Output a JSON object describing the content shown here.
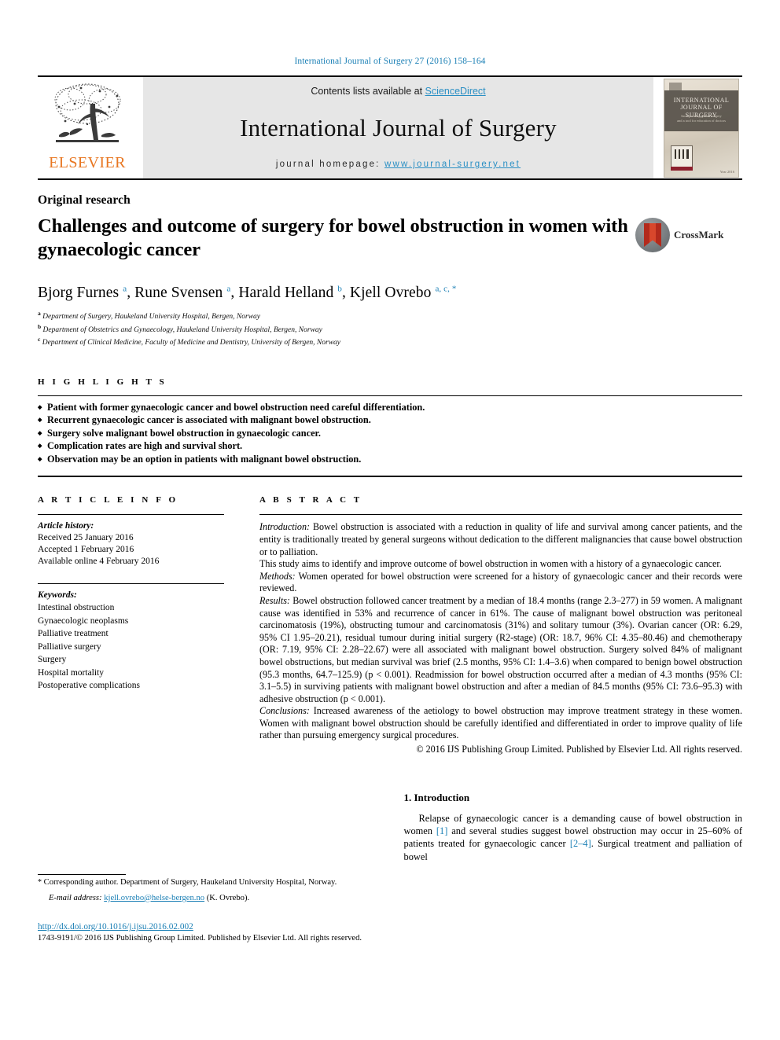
{
  "running_head": "International Journal of Surgery 27 (2016) 158–164",
  "masthead": {
    "publisher_name": "ELSEVIER",
    "contents_prefix": "Contents lists available at ",
    "contents_link": "ScienceDirect",
    "journal_title": "International Journal of Surgery",
    "homepage_prefix": "journal homepage: ",
    "homepage_url": "www.journal-surgery.net",
    "cover": {
      "title_line1": "INTERNATIONAL",
      "title_line2": "JOURNAL OF SURGERY",
      "subtitle_line1": "Incorporating global surgery",
      "subtitle_line2": "and a tool for education of doctors",
      "footer": "Year 2016"
    }
  },
  "article": {
    "type": "Original research",
    "title": "Challenges and outcome of surgery for bowel obstruction in women with gynaecologic cancer",
    "crossmark_label": "CrossMark",
    "authors": [
      {
        "name": "Bjorg Furnes",
        "marks": "a"
      },
      {
        "name": "Rune Svensen",
        "marks": "a"
      },
      {
        "name": "Harald Helland",
        "marks": "b"
      },
      {
        "name": "Kjell Ovrebo",
        "marks": "a, c, *"
      }
    ],
    "affiliations": [
      {
        "mark": "a",
        "text": "Department of Surgery, Haukeland University Hospital, Bergen, Norway"
      },
      {
        "mark": "b",
        "text": "Department of Obstetrics and Gynaecology, Haukeland University Hospital, Bergen, Norway"
      },
      {
        "mark": "c",
        "text": "Department of Clinical Medicine, Faculty of Medicine and Dentistry, University of Bergen, Norway"
      }
    ]
  },
  "highlights": {
    "label": "H I G H L I G H T S",
    "items": [
      "Patient with former gynaecologic cancer and bowel obstruction need careful differentiation.",
      "Recurrent gynaecologic cancer is associated with malignant bowel obstruction.",
      "Surgery solve malignant bowel obstruction in gynaecologic cancer.",
      "Complication rates are high and survival short.",
      "Observation may be an option in patients with malignant bowel obstruction."
    ]
  },
  "article_info": {
    "label": "A R T I C L E  I N F O",
    "history_label": "Article history:",
    "history": [
      "Received 25 January 2016",
      "Accepted 1 February 2016",
      "Available online 4 February 2016"
    ],
    "keywords_label": "Keywords:",
    "keywords": [
      "Intestinal obstruction",
      "Gynaecologic neoplasms",
      "Palliative treatment",
      "Palliative surgery",
      "Surgery",
      "Hospital mortality",
      "Postoperative complications"
    ]
  },
  "abstract": {
    "label": "A B S T R A C T",
    "intro_label": "Introduction:",
    "intro_text": " Bowel obstruction is associated with a reduction in quality of life and survival among cancer patients, and the entity is traditionally treated by general surgeons without dedication to the different malignancies that cause bowel obstruction or to palliation.",
    "aim_text": "This study aims to identify and improve outcome of bowel obstruction in women with a history of a gynaecologic cancer.",
    "methods_label": "Methods:",
    "methods_text": " Women operated for bowel obstruction were screened for a history of gynaecologic cancer and their records were reviewed.",
    "results_label": "Results:",
    "results_text": " Bowel obstruction followed cancer treatment by a median of 18.4 months (range 2.3–277) in 59 women. A malignant cause was identified in 53% and recurrence of cancer in 61%. The cause of malignant bowel obstruction was peritoneal carcinomatosis (19%), obstructing tumour and carcinomatosis (31%) and solitary tumour (3%). Ovarian cancer (OR: 6.29, 95% CI 1.95–20.21), residual tumour during initial surgery (R2-stage) (OR: 18.7, 96% CI: 4.35–80.46) and chemotherapy (OR: 7.19, 95% CI: 2.28–22.67) were all associated with malignant bowel obstruction. Surgery solved 84% of malignant bowel obstructions, but median survival was brief (2.5 months, 95% CI: 1.4–3.6) when compared to benign bowel obstruction (95.3 months, 64.7–125.9) (p < 0.001). Readmission for bowel obstruction occurred after a median of 4.3 months (95% CI: 3.1–5.5) in surviving patients with malignant bowel obstruction and after a median of 84.5 months (95% CI: 73.6–95.3) with adhesive obstruction (p < 0.001).",
    "conclusions_label": "Conclusions:",
    "conclusions_text": " Increased awareness of the aetiology to bowel obstruction may improve treatment strategy in these women. Women with malignant bowel obstruction should be carefully identified and differentiated in order to improve quality of life rather than pursuing emergency surgical procedures.",
    "copyright": "© 2016 IJS Publishing Group Limited. Published by Elsevier Ltd. All rights reserved."
  },
  "introduction": {
    "heading": "1. Introduction",
    "paragraph_1": "Relapse of gynaecologic cancer is a demanding cause of bowel obstruction in women [1] and several studies suggest bowel obstruction may occur in 25–60% of patients treated for gynaecologic cancer [2–4]. Surgical treatment and palliation of bowel"
  },
  "footer": {
    "corresponding_star": "*",
    "corresponding_text": " Corresponding author. Department of Surgery, Haukeland University Hospital, Norway.",
    "email_label": "E-mail address:",
    "email": "kjell.ovrebo@helse-bergen.no",
    "email_suffix": " (K. Ovrebo).",
    "doi": "http://dx.doi.org/10.1016/j.ijsu.2016.02.002",
    "issn_line": "1743-9191/© 2016 IJS Publishing Group Limited. Published by Elsevier Ltd. All rights reserved."
  },
  "colors": {
    "link": "#1a7fb5",
    "elsevier_orange": "#E87722",
    "band_gray": "#e6e6e6",
    "sciencedirect_blue": "#2a8fc4"
  }
}
